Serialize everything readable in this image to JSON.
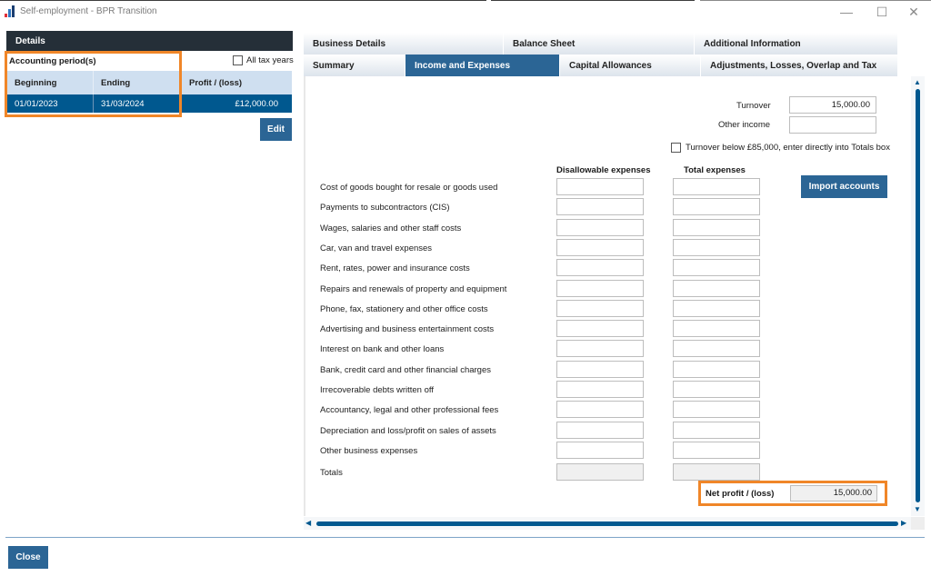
{
  "window": {
    "title": "Self-employment - BPR Transition",
    "controls": {
      "minimize": "—",
      "maximize": "☐",
      "close": "✕"
    }
  },
  "left_panel": {
    "header": "Details",
    "accounting_periods_label": "Accounting period(s)",
    "all_tax_years_label": "All tax years",
    "all_tax_years_checked": false,
    "table": {
      "columns": [
        "Beginning",
        "Ending",
        "Profit / (loss)"
      ],
      "rows": [
        {
          "beginning": "01/01/2023",
          "ending": "31/03/2024",
          "profit_loss": "£12,000.00",
          "selected": true
        }
      ]
    },
    "edit_label": "Edit"
  },
  "tabs": {
    "row1": [
      "Business Details",
      "Balance Sheet",
      "Additional Information"
    ],
    "row2": [
      "Summary",
      "Income and Expenses",
      "Capital Allowances",
      "Adjustments, Losses, Overlap and Tax"
    ],
    "active": "Income and Expenses"
  },
  "income": {
    "turnover_label": "Turnover",
    "turnover_value": "15,000.00",
    "other_income_label": "Other income",
    "other_income_value": "",
    "turnover_below_label": "Turnover below £85,000, enter directly into Totals box",
    "turnover_below_checked": false
  },
  "expenses": {
    "col_disallowable": "Disallowable expenses",
    "col_total": "Total expenses",
    "import_label": "Import accounts",
    "rows": [
      {
        "label": "Cost of goods bought for resale or goods used",
        "disallowable": "",
        "total": ""
      },
      {
        "label": "Payments to subcontractors (CIS)",
        "disallowable": "",
        "total": ""
      },
      {
        "label": "Wages, salaries and other staff costs",
        "disallowable": "",
        "total": ""
      },
      {
        "label": "Car, van and travel expenses",
        "disallowable": "",
        "total": ""
      },
      {
        "label": "Rent, rates, power and insurance costs",
        "disallowable": "",
        "total": ""
      },
      {
        "label": "Repairs and renewals of property and equipment",
        "disallowable": "",
        "total": ""
      },
      {
        "label": "Phone, fax, stationery and other office costs",
        "disallowable": "",
        "total": ""
      },
      {
        "label": "Advertising and business entertainment costs",
        "disallowable": "",
        "total": ""
      },
      {
        "label": "Interest on bank and other loans",
        "disallowable": "",
        "total": ""
      },
      {
        "label": "Bank, credit card and other financial charges",
        "disallowable": "",
        "total": ""
      },
      {
        "label": "Irrecoverable debts written off",
        "disallowable": "",
        "total": ""
      },
      {
        "label": "Accountancy, legal and other professional fees",
        "disallowable": "",
        "total": ""
      },
      {
        "label": "Depreciation and loss/profit on sales of assets",
        "disallowable": "",
        "total": ""
      },
      {
        "label": "Other business expenses",
        "disallowable": "",
        "total": ""
      }
    ],
    "totals_label": "Totals",
    "totals_disallowable": "",
    "totals_total": ""
  },
  "net_profit": {
    "label": "Net profit / (loss)",
    "value": "15,000.00"
  },
  "footer": {
    "close_label": "Close"
  },
  "colors": {
    "accent": "#2b6595",
    "selected_row": "#00588f",
    "highlight": "#f08628",
    "header_dark": "#252f38"
  }
}
